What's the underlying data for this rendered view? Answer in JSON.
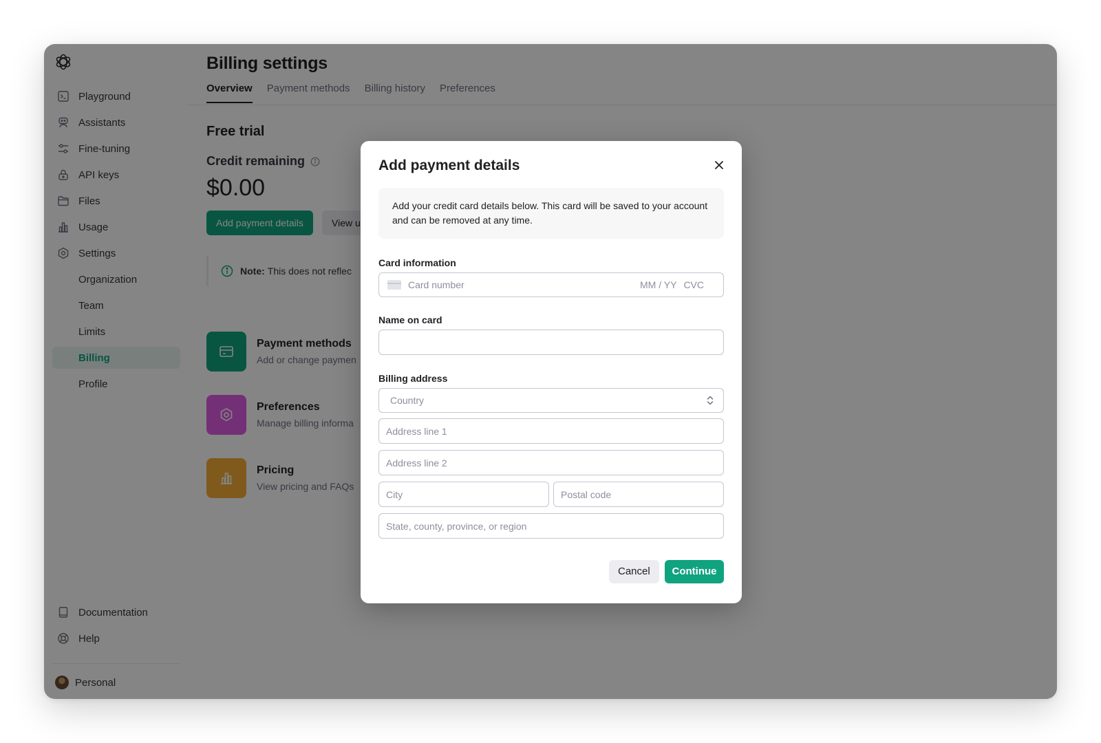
{
  "sidebar": {
    "items": [
      {
        "label": "Playground",
        "icon": "terminal-icon"
      },
      {
        "label": "Assistants",
        "icon": "robot-icon"
      },
      {
        "label": "Fine-tuning",
        "icon": "sliders-icon"
      },
      {
        "label": "API keys",
        "icon": "lock-icon"
      },
      {
        "label": "Files",
        "icon": "folder-icon"
      },
      {
        "label": "Usage",
        "icon": "bar-chart-icon"
      },
      {
        "label": "Settings",
        "icon": "gear-icon"
      }
    ],
    "settings_sub": [
      {
        "label": "Organization"
      },
      {
        "label": "Team"
      },
      {
        "label": "Limits"
      },
      {
        "label": "Billing",
        "active": true
      },
      {
        "label": "Profile"
      }
    ],
    "bottom": [
      {
        "label": "Documentation",
        "icon": "book-icon"
      },
      {
        "label": "Help",
        "icon": "lifebuoy-icon"
      }
    ],
    "account": {
      "label": "Personal"
    }
  },
  "main": {
    "title": "Billing settings",
    "tabs": [
      {
        "label": "Overview",
        "active": true
      },
      {
        "label": "Payment methods"
      },
      {
        "label": "Billing history"
      },
      {
        "label": "Preferences"
      }
    ],
    "section_title": "Free trial",
    "credit_label": "Credit remaining",
    "credit_value": "$0.00",
    "add_payment_button": "Add payment details",
    "view_button": "View u",
    "note_bold": "Note:",
    "note_text": "This does not reflec",
    "cards": [
      {
        "title": "Payment methods",
        "description": "Add or change paymen",
        "color": "#10a37f",
        "icon": "credit-card-icon"
      },
      {
        "title": "Preferences",
        "description": "Manage billing informa",
        "color": "#dd5ce5",
        "icon": "gear-icon"
      },
      {
        "title": "Pricing",
        "description": "View pricing and FAQs",
        "color": "#f4ac36",
        "icon": "bar-chart-icon"
      }
    ]
  },
  "modal": {
    "title": "Add payment details",
    "info": "Add your credit card details below. This card will be saved to your account and can be removed at any time.",
    "card_info_label": "Card information",
    "card_number_placeholder": "Card number",
    "expiry_placeholder": "MM / YY",
    "cvc_placeholder": "CVC",
    "name_label": "Name on card",
    "name_value": "",
    "billing_label": "Billing address",
    "country_placeholder": "Country",
    "address1_placeholder": "Address line 1",
    "address2_placeholder": "Address line 2",
    "city_placeholder": "City",
    "postal_placeholder": "Postal code",
    "state_placeholder": "State, county, province, or region",
    "cancel_label": "Cancel",
    "continue_label": "Continue"
  },
  "colors": {
    "accent": "#10a37f",
    "overlay": "rgba(0,0,0,0.48)"
  }
}
